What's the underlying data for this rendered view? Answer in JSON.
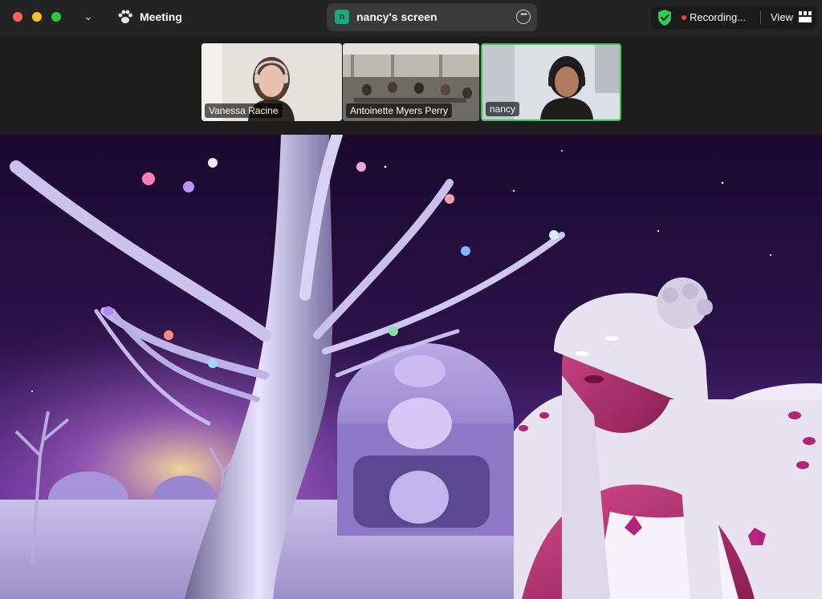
{
  "window": {
    "meeting_title": "Meeting",
    "share_title": "nancy's screen",
    "share_avatar_letter": "n",
    "recording_label": "Recording...",
    "view_label": "View"
  },
  "participants": [
    {
      "name": "Vanessa Racine",
      "active": false
    },
    {
      "name": "Antoinette Myers Perry",
      "active": false
    },
    {
      "name": "nancy",
      "active": true
    }
  ],
  "colors": {
    "active_speaker_border": "#35c759",
    "recording_dot": "#ff3b30",
    "share_avatar": "#1aa883"
  },
  "icons": {
    "close": "close-icon",
    "minimize": "minimize-icon",
    "zoom": "zoom-icon",
    "chevron": "chevron-down-icon",
    "meeting": "paw-icon",
    "more": "more-options-icon",
    "security": "shield-check-icon",
    "view": "gallery-view-icon"
  }
}
